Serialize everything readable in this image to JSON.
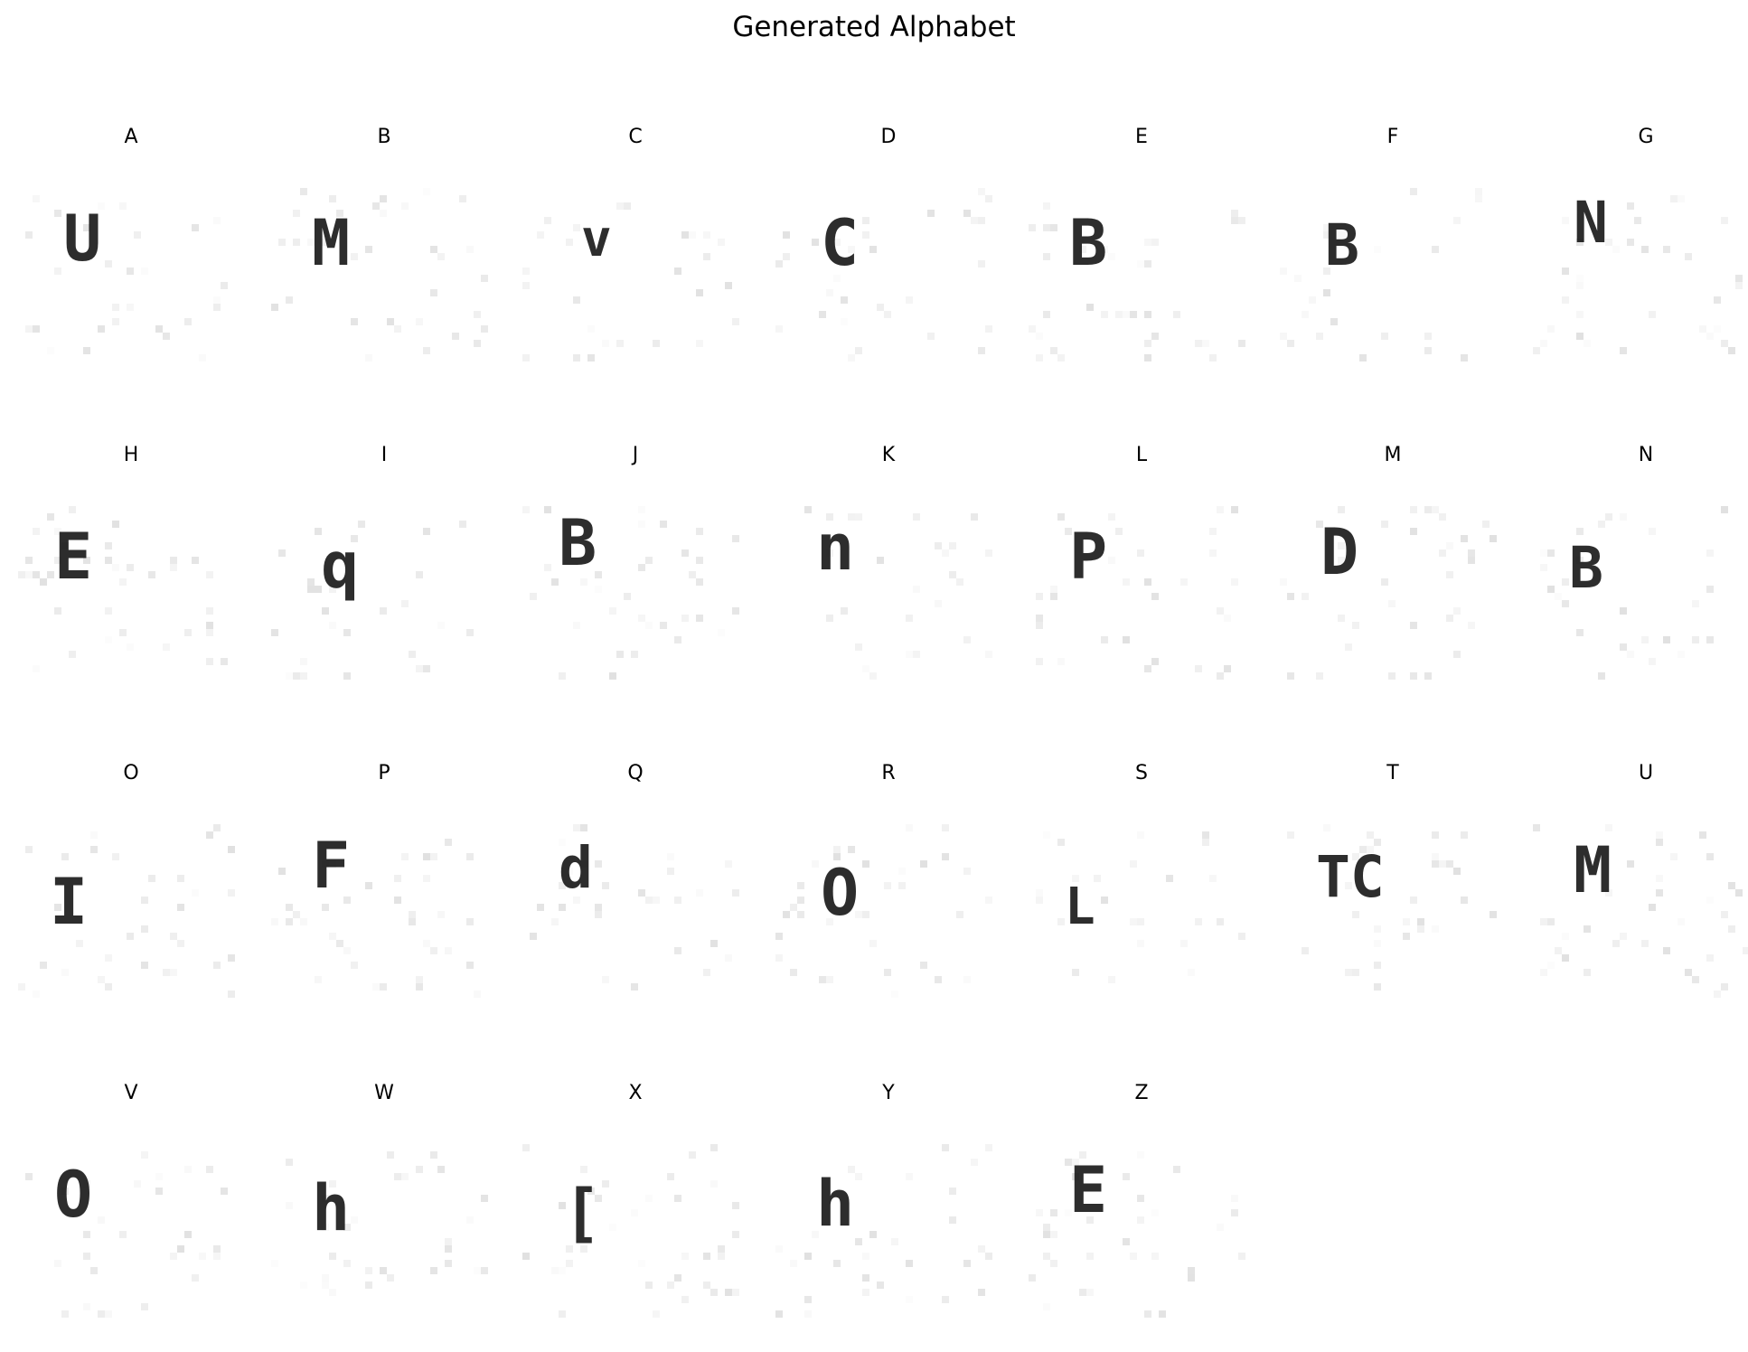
{
  "figure": {
    "title": "Generated Alphabet"
  },
  "panels": [
    {
      "label": "A",
      "glyph": "U"
    },
    {
      "label": "B",
      "glyph": "M"
    },
    {
      "label": "C",
      "glyph": "v"
    },
    {
      "label": "D",
      "glyph": "C"
    },
    {
      "label": "E",
      "glyph": "B"
    },
    {
      "label": "F",
      "glyph": "B"
    },
    {
      "label": "G",
      "glyph": "N"
    },
    {
      "label": "H",
      "glyph": "E"
    },
    {
      "label": "I",
      "glyph": "q"
    },
    {
      "label": "J",
      "glyph": "B"
    },
    {
      "label": "K",
      "glyph": "n"
    },
    {
      "label": "L",
      "glyph": "P"
    },
    {
      "label": "M",
      "glyph": "D"
    },
    {
      "label": "N",
      "glyph": "B"
    },
    {
      "label": "O",
      "glyph": "I"
    },
    {
      "label": "P",
      "glyph": "F"
    },
    {
      "label": "Q",
      "glyph": "d"
    },
    {
      "label": "R",
      "glyph": "O"
    },
    {
      "label": "S",
      "glyph": "L"
    },
    {
      "label": "T",
      "glyph": "TC"
    },
    {
      "label": "U",
      "glyph": "M"
    },
    {
      "label": "V",
      "glyph": "O"
    },
    {
      "label": "W",
      "glyph": "h"
    },
    {
      "label": "X",
      "glyph": "["
    },
    {
      "label": "Y",
      "glyph": "h"
    },
    {
      "label": "Z",
      "glyph": "E"
    }
  ]
}
